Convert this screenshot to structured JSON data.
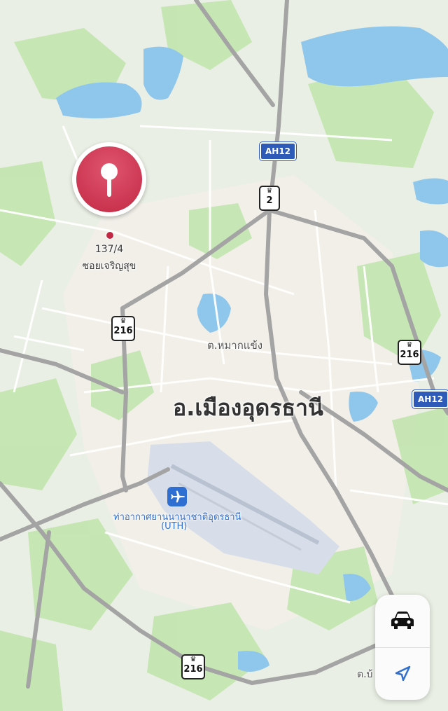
{
  "map": {
    "colors": {
      "background": "#e9efe4",
      "water": "#8fc6ec",
      "green": "#bde3a8",
      "major_road": "#a4a4a4",
      "minor_road": "#ffffff",
      "airport": "#d8dee9",
      "pin": "#c22843",
      "airport_label": "#2f6fd1",
      "ah_shield": "#2f5bb8"
    },
    "pin": {
      "icon": "map-pin-icon",
      "address_line1": "137/4",
      "address_line2": "ซอยเจริญสุข"
    },
    "labels": {
      "district": "อ.เมืองอุดรธานี",
      "subdistrict": "ต.หมากแข้ง",
      "bottom_partial": "ต.บ้"
    },
    "airport": {
      "icon": "airplane-icon",
      "name": "ท่าอากาศยานนานาชาติอุดรธานี",
      "code": "(UTH)"
    },
    "shields": {
      "ah12_top": "AH12",
      "ah12_right": "AH12",
      "route2": "2",
      "route216_left": "216",
      "route216_right": "216",
      "route216_bottom": "216"
    }
  },
  "controls": {
    "transport_mode_icon": "car-icon",
    "location_icon": "location-arrow-icon"
  }
}
